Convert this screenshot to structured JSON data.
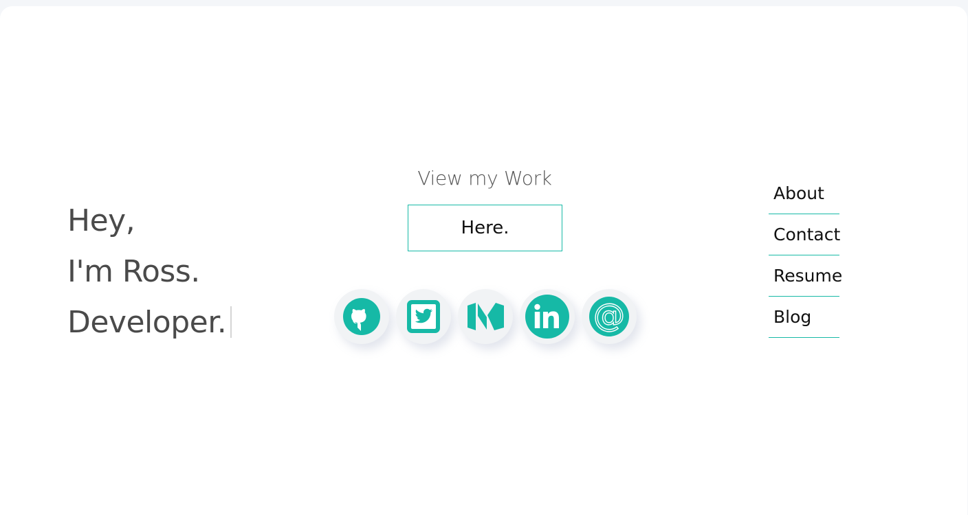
{
  "intro": {
    "line1": "Hey,",
    "line2": "I'm Ross.",
    "line3": "Developer."
  },
  "work": {
    "title": "View my Work",
    "button_label": "Here."
  },
  "socials": [
    {
      "icon": "github-icon"
    },
    {
      "icon": "twitter-icon"
    },
    {
      "icon": "medium-icon"
    },
    {
      "icon": "linkedin-icon"
    },
    {
      "icon": "email-at-icon"
    }
  ],
  "nav": {
    "items": [
      {
        "label": "About"
      },
      {
        "label": "Contact"
      },
      {
        "label": "Resume"
      },
      {
        "label": "Blog"
      }
    ]
  },
  "colors": {
    "accent": "#16b9a6",
    "text_dark": "#4a4a4a",
    "background": "#ffffff"
  }
}
